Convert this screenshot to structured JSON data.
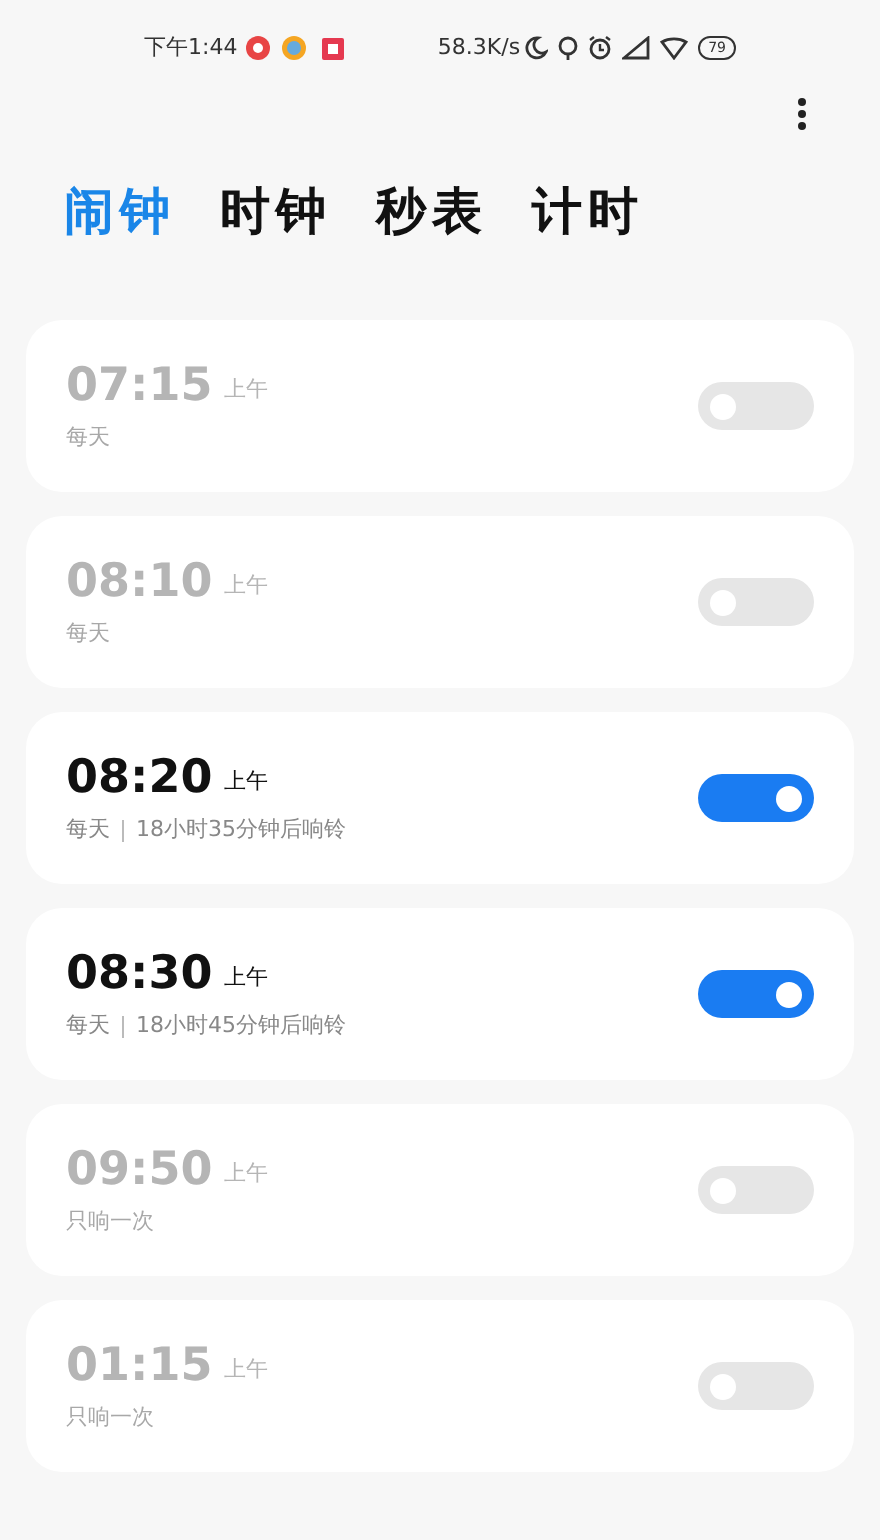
{
  "status_bar": {
    "time": "下午1:44",
    "speed": "58.3K/s",
    "battery": "79"
  },
  "tabs": [
    {
      "label": "闹钟",
      "selected": true
    },
    {
      "label": "时钟",
      "selected": false
    },
    {
      "label": "秒表",
      "selected": false
    },
    {
      "label": "计时",
      "selected": false
    }
  ],
  "alarms": [
    {
      "time": "07:15",
      "period": "上午",
      "repeat": "每天",
      "on": false
    },
    {
      "time": "08:10",
      "period": "上午",
      "repeat": "每天",
      "on": false
    },
    {
      "time": "08:20",
      "period": "上午",
      "repeat": "每天",
      "countdown": "18小时35分钟后响铃",
      "on": true
    },
    {
      "time": "08:30",
      "period": "上午",
      "repeat": "每天",
      "countdown": "18小时45分钟后响铃",
      "on": true
    },
    {
      "time": "09:50",
      "period": "上午",
      "repeat": "只响一次",
      "on": false
    },
    {
      "time": "01:15",
      "period": "上午",
      "repeat": "只响一次",
      "on": false
    }
  ]
}
